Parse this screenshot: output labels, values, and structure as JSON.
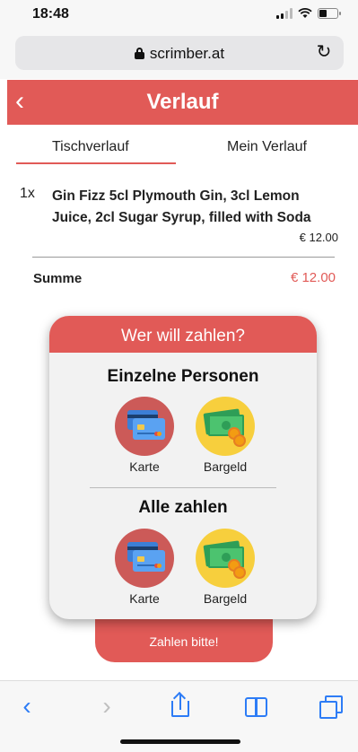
{
  "status_bar": {
    "time": "18:48"
  },
  "browser": {
    "url": "scrimber.at"
  },
  "header": {
    "title": "Verlauf"
  },
  "tabs": [
    {
      "label": "Tischverlauf",
      "active": true
    },
    {
      "label": "Mein Verlauf",
      "active": false
    }
  ],
  "order": {
    "items": [
      {
        "quantity": "1x",
        "name": "Gin Fizz 5cl Plymouth Gin, 3cl Lemon Juice, 2cl Sugar Syrup, filled with Soda",
        "price": "€ 12.00"
      }
    ],
    "sum_label": "Summe",
    "sum_value": "€ 12.00"
  },
  "modal": {
    "title": "Wer will zahlen?",
    "sections": [
      {
        "title": "Einzelne Personen",
        "options": [
          {
            "label": "Karte",
            "icon": "credit-card-icon"
          },
          {
            "label": "Bargeld",
            "icon": "cash-icon"
          }
        ]
      },
      {
        "title": "Alle zahlen",
        "options": [
          {
            "label": "Karte",
            "icon": "credit-card-icon"
          },
          {
            "label": "Bargeld",
            "icon": "cash-icon"
          }
        ]
      }
    ]
  },
  "pay_button": {
    "label": "Zahlen bitte!"
  },
  "colors": {
    "accent": "#e15a57",
    "card": "#cc5a58",
    "cash": "#f7cf3d",
    "ios_blue": "#2d7cf6"
  }
}
